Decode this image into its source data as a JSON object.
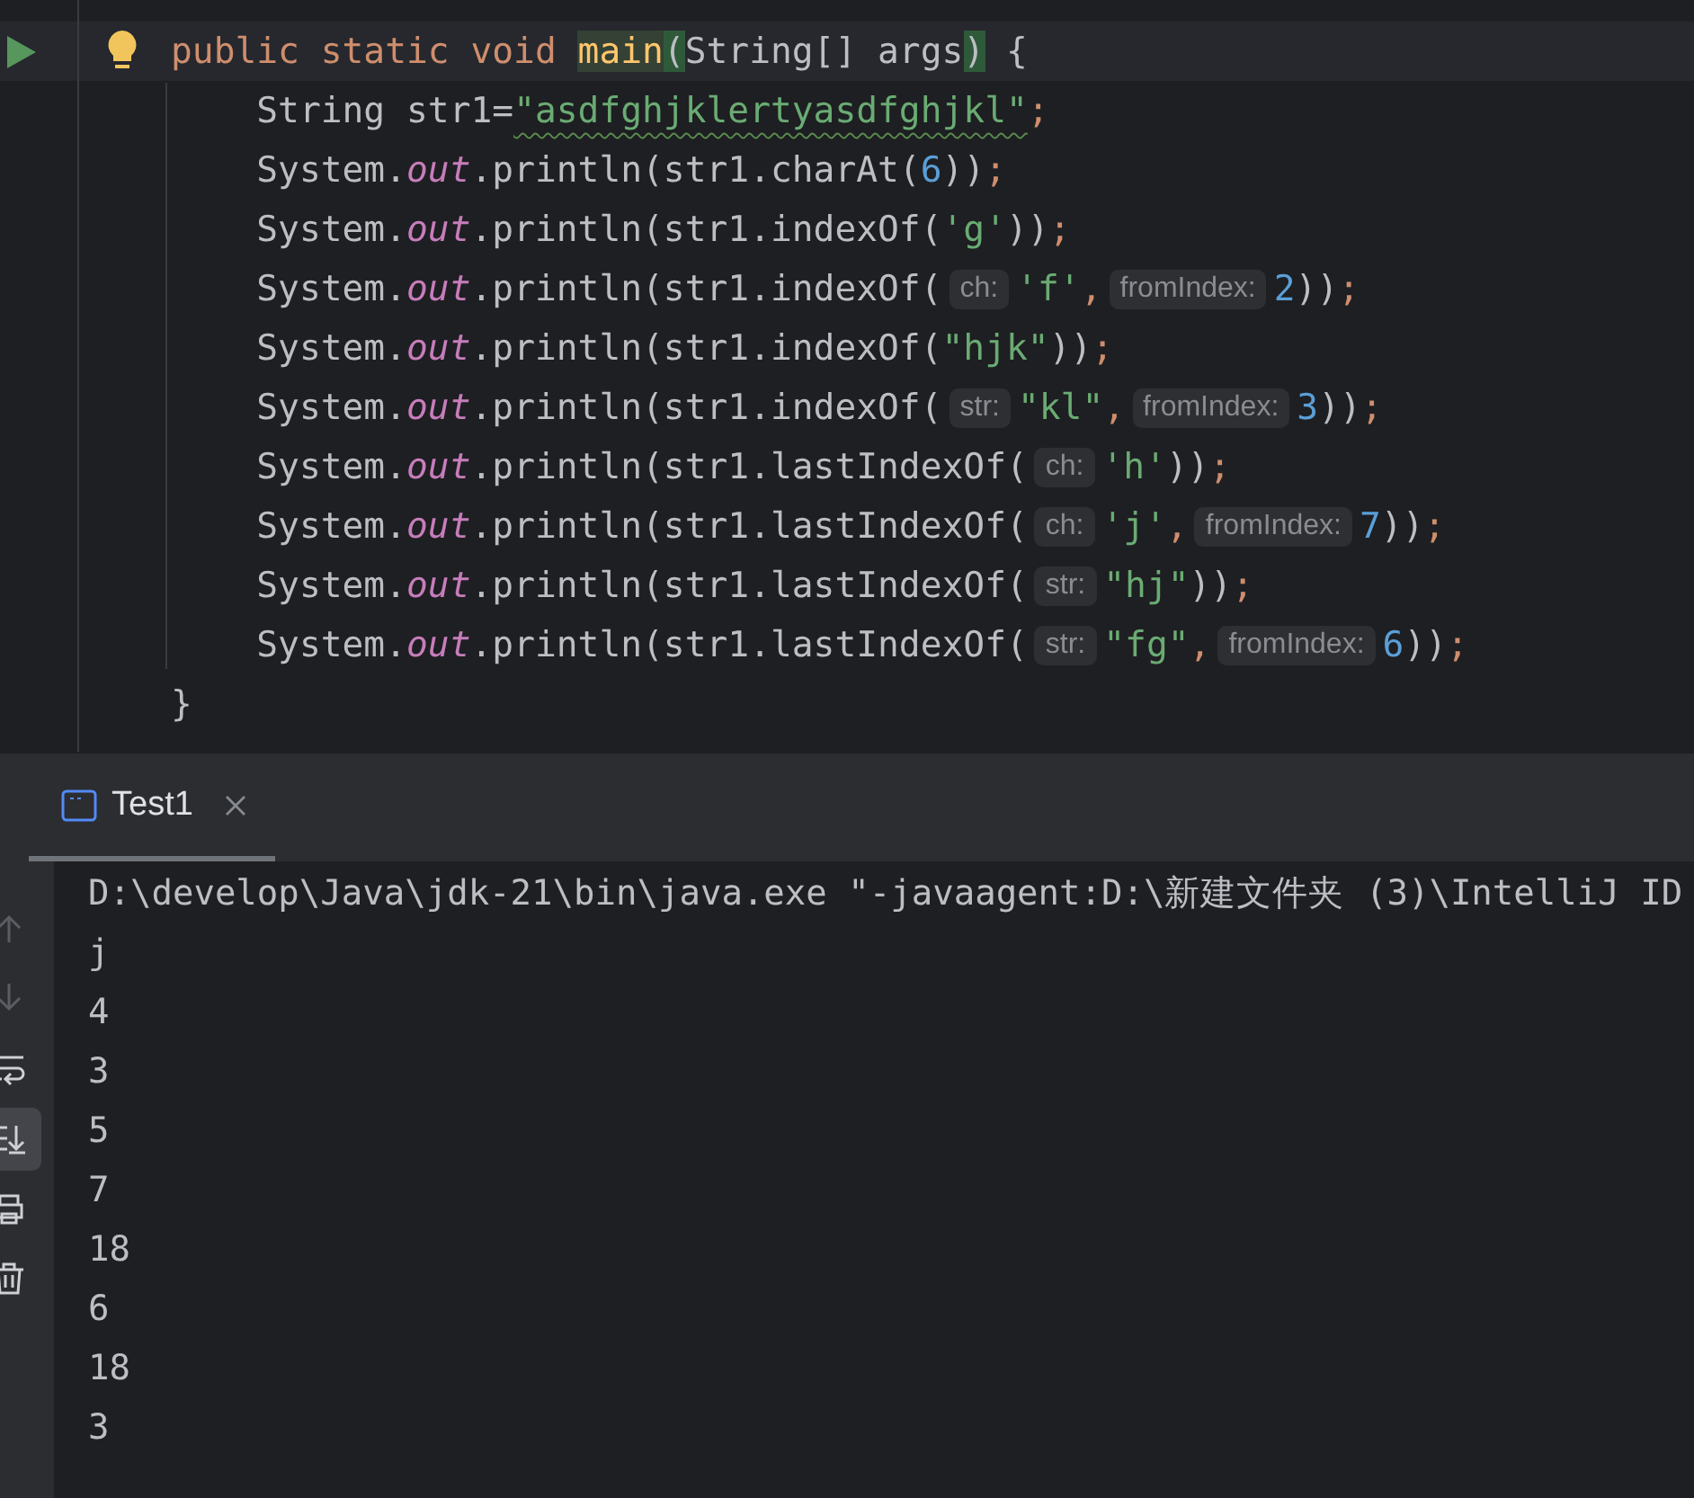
{
  "editor": {
    "lines": [
      {
        "current": true,
        "run_marker": true,
        "intention_bulb": true,
        "tokens": [
          {
            "kind": "keyword",
            "text": "public static void "
          },
          {
            "kind": "usage",
            "text": "main"
          },
          {
            "kind": "match",
            "text": "("
          },
          {
            "kind": "text",
            "text": "String[] args"
          },
          {
            "kind": "match",
            "text": ")"
          },
          {
            "kind": "text",
            "text": " {"
          }
        ]
      },
      {
        "current": false,
        "tokens": [
          {
            "kind": "text",
            "text": "    String str1="
          },
          {
            "kind": "string-warn",
            "text": "\"asdfghjklertyasdfghjkl\""
          },
          {
            "kind": "punct",
            "text": ";"
          }
        ]
      },
      {
        "current": false,
        "tokens": [
          {
            "kind": "text",
            "text": "    System."
          },
          {
            "kind": "field",
            "text": "out"
          },
          {
            "kind": "text",
            "text": ".println(str1.charAt("
          },
          {
            "kind": "number",
            "text": "6"
          },
          {
            "kind": "text",
            "text": "))"
          },
          {
            "kind": "punct",
            "text": ";"
          }
        ]
      },
      {
        "current": false,
        "tokens": [
          {
            "kind": "text",
            "text": "    System."
          },
          {
            "kind": "field",
            "text": "out"
          },
          {
            "kind": "text",
            "text": ".println(str1.indexOf("
          },
          {
            "kind": "string",
            "text": "'g'"
          },
          {
            "kind": "text",
            "text": "))"
          },
          {
            "kind": "punct",
            "text": ";"
          }
        ]
      },
      {
        "current": false,
        "tokens": [
          {
            "kind": "text",
            "text": "    System."
          },
          {
            "kind": "field",
            "text": "out"
          },
          {
            "kind": "text",
            "text": ".println(str1.indexOf("
          },
          {
            "kind": "hint",
            "text": "ch:"
          },
          {
            "kind": "string",
            "text": "'f'"
          },
          {
            "kind": "punct",
            "text": ","
          },
          {
            "kind": "hint",
            "text": "fromIndex:"
          },
          {
            "kind": "number",
            "text": "2"
          },
          {
            "kind": "text",
            "text": "))"
          },
          {
            "kind": "punct",
            "text": ";"
          }
        ]
      },
      {
        "current": false,
        "tokens": [
          {
            "kind": "text",
            "text": "    System."
          },
          {
            "kind": "field",
            "text": "out"
          },
          {
            "kind": "text",
            "text": ".println(str1.indexOf("
          },
          {
            "kind": "string",
            "text": "\"hjk\""
          },
          {
            "kind": "text",
            "text": "))"
          },
          {
            "kind": "punct",
            "text": ";"
          }
        ]
      },
      {
        "current": false,
        "tokens": [
          {
            "kind": "text",
            "text": "    System."
          },
          {
            "kind": "field",
            "text": "out"
          },
          {
            "kind": "text",
            "text": ".println(str1.indexOf("
          },
          {
            "kind": "hint",
            "text": "str:"
          },
          {
            "kind": "string",
            "text": "\"kl\""
          },
          {
            "kind": "punct",
            "text": ","
          },
          {
            "kind": "hint",
            "text": "fromIndex:"
          },
          {
            "kind": "number",
            "text": "3"
          },
          {
            "kind": "text",
            "text": "))"
          },
          {
            "kind": "punct",
            "text": ";"
          }
        ]
      },
      {
        "current": false,
        "tokens": [
          {
            "kind": "text",
            "text": "    System."
          },
          {
            "kind": "field",
            "text": "out"
          },
          {
            "kind": "text",
            "text": ".println(str1.lastIndexOf("
          },
          {
            "kind": "hint",
            "text": "ch:"
          },
          {
            "kind": "string",
            "text": "'h'"
          },
          {
            "kind": "text",
            "text": "))"
          },
          {
            "kind": "punct",
            "text": ";"
          }
        ]
      },
      {
        "current": false,
        "tokens": [
          {
            "kind": "text",
            "text": "    System."
          },
          {
            "kind": "field",
            "text": "out"
          },
          {
            "kind": "text",
            "text": ".println(str1.lastIndexOf("
          },
          {
            "kind": "hint",
            "text": "ch:"
          },
          {
            "kind": "string",
            "text": "'j'"
          },
          {
            "kind": "punct",
            "text": ","
          },
          {
            "kind": "hint",
            "text": "fromIndex:"
          },
          {
            "kind": "number",
            "text": "7"
          },
          {
            "kind": "text",
            "text": "))"
          },
          {
            "kind": "punct",
            "text": ";"
          }
        ]
      },
      {
        "current": false,
        "tokens": [
          {
            "kind": "text",
            "text": "    System."
          },
          {
            "kind": "field",
            "text": "out"
          },
          {
            "kind": "text",
            "text": ".println(str1.lastIndexOf("
          },
          {
            "kind": "hint",
            "text": "str:"
          },
          {
            "kind": "string",
            "text": "\"hj\""
          },
          {
            "kind": "text",
            "text": "))"
          },
          {
            "kind": "punct",
            "text": ";"
          }
        ]
      },
      {
        "current": false,
        "tokens": [
          {
            "kind": "text",
            "text": "    System."
          },
          {
            "kind": "field",
            "text": "out"
          },
          {
            "kind": "text",
            "text": ".println(str1.lastIndexOf("
          },
          {
            "kind": "hint",
            "text": "str:"
          },
          {
            "kind": "string",
            "text": "\"fg\""
          },
          {
            "kind": "punct",
            "text": ","
          },
          {
            "kind": "hint",
            "text": "fromIndex:"
          },
          {
            "kind": "number",
            "text": "6"
          },
          {
            "kind": "text",
            "text": "))"
          },
          {
            "kind": "punct",
            "text": ";"
          }
        ]
      },
      {
        "current": false,
        "tokens": [
          {
            "kind": "text",
            "text": "}"
          }
        ]
      }
    ]
  },
  "run_panel": {
    "tabs": [
      {
        "label": "Test1",
        "selected": true
      }
    ],
    "toolbar": [
      {
        "kind": "up",
        "disabled": true,
        "selected": false
      },
      {
        "kind": "down",
        "disabled": true,
        "selected": false
      },
      {
        "kind": "wrap",
        "disabled": false,
        "selected": false
      },
      {
        "kind": "scroll-end",
        "disabled": false,
        "selected": true
      },
      {
        "kind": "print",
        "disabled": false,
        "selected": false
      },
      {
        "kind": "trash",
        "disabled": false,
        "selected": false
      }
    ],
    "console": [
      "D:\\develop\\Java\\jdk-21\\bin\\java.exe \"-javaagent:D:\\新建文件夹 (3)\\IntelliJ ID",
      "j",
      "4",
      "3",
      "5",
      "7",
      "18",
      "6",
      "18",
      "3"
    ]
  }
}
